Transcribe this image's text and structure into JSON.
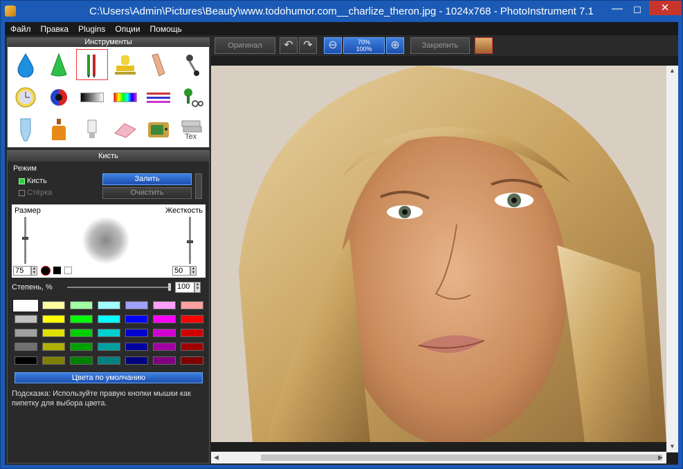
{
  "window": {
    "title": "C:\\Users\\Admin\\Pictures\\Beauty\\www.todohumor.com__charlize_theron.jpg - 1024x768 - PhotoInstrument 7.1",
    "minimize": "—",
    "maximize": "☐",
    "close": "✕"
  },
  "menu": [
    "Файл",
    "Правка",
    "Plugins",
    "Опции",
    "Помощь"
  ],
  "tools_panel": {
    "header": "Инструменты",
    "tools": [
      "drop-icon",
      "cone-icon",
      "brush-pencil-icon",
      "stamp-icon",
      "finger-icon",
      "pin-icon",
      "clock-icon",
      "color-circle-icon",
      "gradient-icon",
      "rainbow-icon",
      "lines-icon",
      "scissors-plant-icon",
      "tube-icon",
      "bottle-icon",
      "lightbulb-icon",
      "eraser-icon",
      "tv-icon",
      "text-layers-icon"
    ]
  },
  "brush_panel": {
    "header": "Кисть",
    "mode_label": "Режим",
    "brush_option": "Кисть",
    "eraser_option": "Стёрка",
    "fill_button": "Залить",
    "clear_button": "Очистить",
    "size_label": "Размер",
    "hardness_label": "Жесткость",
    "size_value": "75",
    "hardness_value": "50",
    "strength_label": "Степень, %",
    "strength_value": "100",
    "default_colors_button": "Цвета по умолчанию",
    "hint": "Подсказка: Используйте правую кнопки мышки как пипетку для выбора цвета."
  },
  "palette": [
    [
      "#ffffff",
      "#ffffa0",
      "#a0ffa0",
      "#a0ffff",
      "#a0a0ff",
      "#ffa0ff",
      "#ffa0a0"
    ],
    [
      "#c0c0c0",
      "#ffff00",
      "#00ff00",
      "#00ffff",
      "#0000ff",
      "#ff00ff",
      "#ff0000"
    ],
    [
      "#a0a0a0",
      "#e0e000",
      "#00d000",
      "#00d0d0",
      "#0000d0",
      "#d000d0",
      "#d00000"
    ],
    [
      "#707070",
      "#b0b000",
      "#00a000",
      "#00a0a0",
      "#0000a0",
      "#a000a0",
      "#a00000"
    ],
    [
      "#000000",
      "#808000",
      "#008000",
      "#008080",
      "#000080",
      "#800080",
      "#800000"
    ]
  ],
  "toolbar": {
    "original": "Оригинал",
    "zoom_top": "70%",
    "zoom_bottom": "100%",
    "pin": "Закрепить"
  }
}
